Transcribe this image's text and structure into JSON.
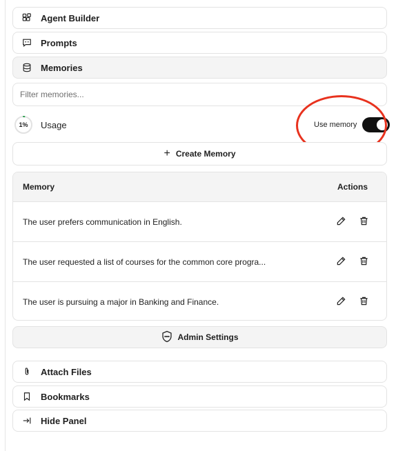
{
  "nav_top": [
    {
      "label": "Agent Builder",
      "icon": "agent-builder-icon"
    },
    {
      "label": "Prompts",
      "icon": "prompts-icon"
    },
    {
      "label": "Memories",
      "icon": "database-icon",
      "active": true
    }
  ],
  "memories": {
    "filter_placeholder": "Filter memories...",
    "usage": {
      "percent_label": "1%",
      "label": "Usage",
      "fraction": 0.01
    },
    "use_memory": {
      "label": "Use memory",
      "enabled": true
    },
    "create_label": "Create Memory",
    "table": {
      "headers": {
        "memory": "Memory",
        "actions": "Actions"
      },
      "rows": [
        {
          "text": "The user prefers communication in English."
        },
        {
          "text": "The user requested a list of courses for the common core progra..."
        },
        {
          "text": "The user is pursuing a major in Banking and Finance."
        }
      ]
    },
    "admin_settings_label": "Admin Settings"
  },
  "nav_bottom": [
    {
      "label": "Attach Files",
      "icon": "paperclip-icon"
    },
    {
      "label": "Bookmarks",
      "icon": "bookmark-icon"
    },
    {
      "label": "Hide Panel",
      "icon": "hide-panel-icon"
    }
  ],
  "colors": {
    "highlight": "#e8321e",
    "toggle_on": "#111111",
    "usage_ring": "#2e9e4f"
  }
}
